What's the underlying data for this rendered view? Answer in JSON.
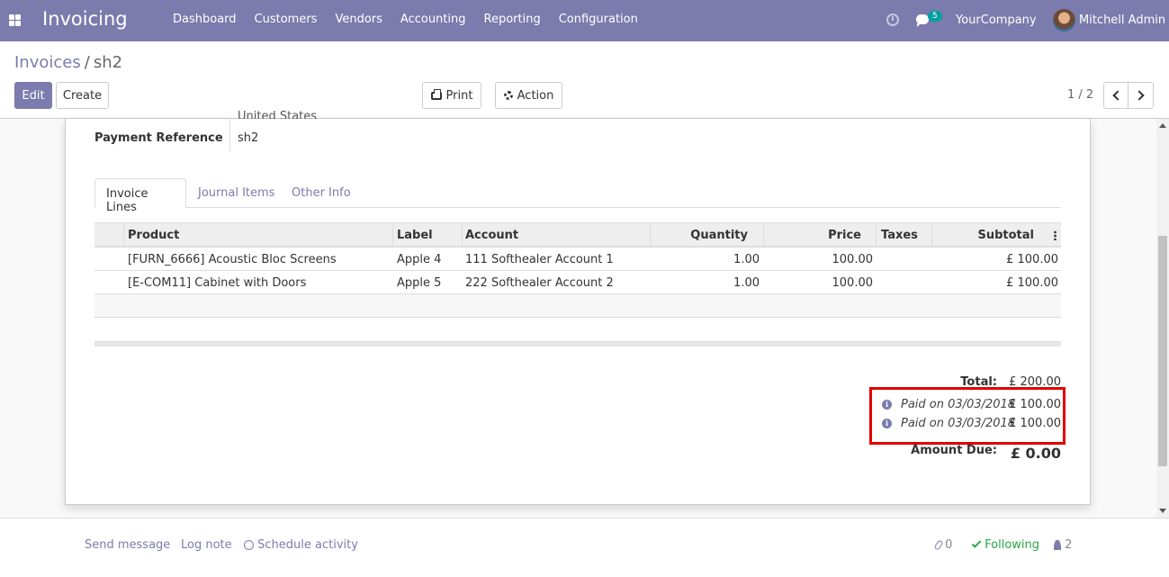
{
  "navbar": {
    "app_name": "Invoicing",
    "menu": [
      "Dashboard",
      "Customers",
      "Vendors",
      "Accounting",
      "Reporting",
      "Configuration"
    ],
    "messages_badge": "5",
    "company": "YourCompany",
    "user": "Mitchell Admin",
    "color": "#7c7bad"
  },
  "control": {
    "breadcrumb_parent": "Invoices",
    "breadcrumb_sep": "/",
    "breadcrumb_current": "sh2",
    "edit_label": "Edit",
    "create_label": "Create",
    "print_label": "Print",
    "action_label": "Action",
    "pager": "1 / 2"
  },
  "form": {
    "country_partial": "United States",
    "payment_reference_label": "Payment Reference",
    "payment_reference_value": "sh2"
  },
  "tabs": [
    "Invoice Lines",
    "Journal Items",
    "Other Info"
  ],
  "table": {
    "headers": {
      "product": "Product",
      "label": "Label",
      "account": "Account",
      "quantity": "Quantity",
      "price": "Price",
      "taxes": "Taxes",
      "subtotal": "Subtotal"
    },
    "rows": [
      {
        "product": "[FURN_6666] Acoustic Bloc Screens",
        "label": "Apple 4",
        "account": "111 Softhealer Account 1",
        "quantity": "1.00",
        "price": "100.00",
        "taxes": "",
        "subtotal": "£ 100.00"
      },
      {
        "product": "[E-COM11] Cabinet with Doors",
        "label": "Apple 5",
        "account": "222 Softhealer Account 2",
        "quantity": "1.00",
        "price": "100.00",
        "taxes": "",
        "subtotal": "£ 100.00"
      }
    ]
  },
  "totals": {
    "total_label": "Total:",
    "total_value": "£ 200.00",
    "payments": [
      {
        "label": "Paid on 03/03/2018",
        "amount": "£ 100.00"
      },
      {
        "label": "Paid on 03/03/2018",
        "amount": "£ 100.00"
      }
    ],
    "amount_due_label": "Amount Due:",
    "amount_due_value": "£ 0.00",
    "highlight_color": "#e00000"
  },
  "chatter": {
    "send_message": "Send message",
    "log_note": "Log note",
    "schedule_activity": "Schedule activity",
    "attachments_count": "0",
    "following": "Following",
    "followers_count": "2"
  }
}
